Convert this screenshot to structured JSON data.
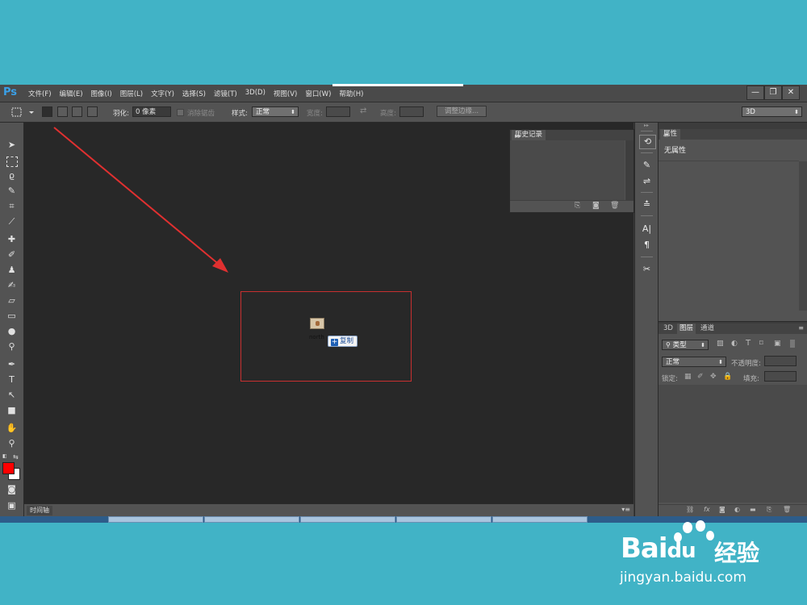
{
  "app": {
    "logo": "Ps"
  },
  "menu": [
    "文件(F)",
    "编辑(E)",
    "图像(I)",
    "图层(L)",
    "文字(Y)",
    "选择(S)",
    "滤镜(T)",
    "3D(D)",
    "视图(V)",
    "窗口(W)",
    "帮助(H)"
  ],
  "window_controls": {
    "minimize": "—",
    "restore": "❐",
    "close": "✕"
  },
  "options": {
    "feather_label": "羽化:",
    "feather_value": "0 像素",
    "antialias_label": "消除锯齿",
    "style_label": "样式:",
    "style_value": "正常",
    "width_label": "宽度:",
    "height_label": "高度:",
    "refine_edge_label": "调整边缘...",
    "workspace_value": "3D"
  },
  "panels": {
    "history": {
      "title": "历史记录"
    },
    "properties": {
      "title": "属性",
      "content": "无属性"
    },
    "layers": {
      "tabs": [
        "3D",
        "图层",
        "通道"
      ],
      "active_tab": 1,
      "filter_value": "类型",
      "blend_mode": "正常",
      "opacity_label": "不透明度:",
      "lock_label": "锁定:",
      "fill_label": "填充:"
    },
    "timeline": {
      "title": "时间轴"
    }
  },
  "drag": {
    "file_name": "north",
    "copy_label": "复制"
  },
  "colors": {
    "foreground": "#ff0000",
    "background": "#ffffff",
    "accent_arrow": "#e03030"
  },
  "watermark": {
    "brand": "Bai",
    "brand_paw": "du",
    "brand_cn": "经验",
    "url": "jingyan.baidu.com"
  }
}
